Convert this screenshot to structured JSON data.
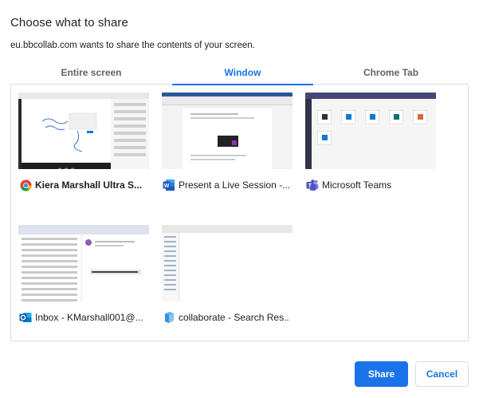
{
  "dialog": {
    "title": "Choose what to share",
    "subtitle": "eu.bbcollab.com wants to share the contents of your screen."
  },
  "tabs": [
    {
      "label": "Entire screen",
      "selected": false
    },
    {
      "label": "Window",
      "selected": true
    },
    {
      "label": "Chrome Tab",
      "selected": false
    }
  ],
  "windows": [
    {
      "label": "Kiera Marshall Ultra S...",
      "icon": "chrome-icon"
    },
    {
      "label": "Present a Live Session -...",
      "icon": "word-icon"
    },
    {
      "label": "Microsoft Teams",
      "icon": "teams-icon"
    },
    {
      "label": "Inbox - KMarshall001@...",
      "icon": "outlook-icon"
    },
    {
      "label": "collaborate - Search Res...",
      "icon": "file-explorer-icon"
    }
  ],
  "buttons": {
    "share": "Share",
    "cancel": "Cancel"
  },
  "colors": {
    "accent": "#1a73e8",
    "text": "#202124",
    "muted": "#5f6368",
    "border": "#dadce0"
  }
}
